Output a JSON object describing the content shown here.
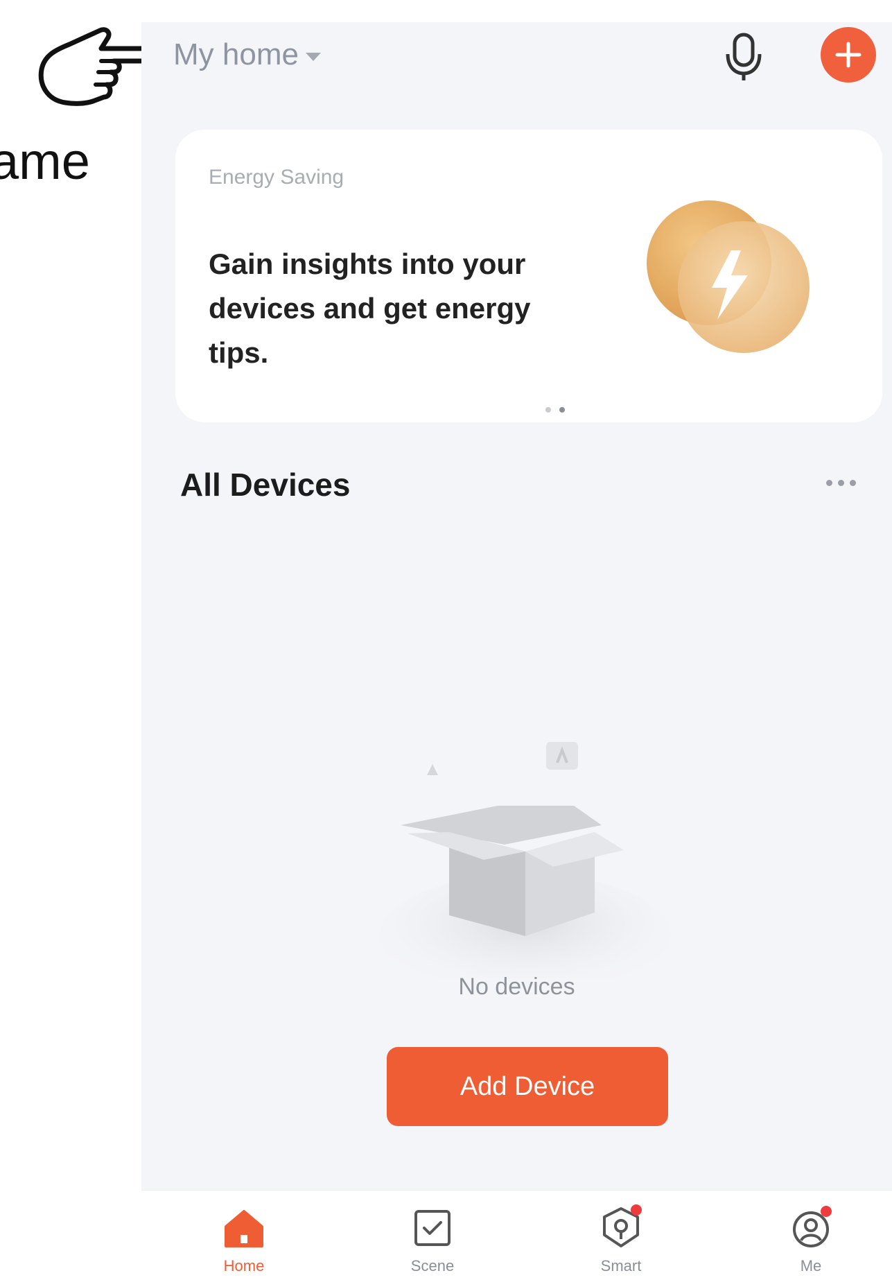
{
  "annotation": {
    "label": "ame"
  },
  "header": {
    "home_name": "My home"
  },
  "energy_card": {
    "tag": "Energy Saving",
    "message": "Gain insights into your devices and get energy tips."
  },
  "devices": {
    "title": "All Devices",
    "empty_text": "No devices",
    "add_button": "Add Device"
  },
  "tabbar": {
    "tabs": [
      {
        "label": "Home",
        "icon": "home-icon",
        "active": true
      },
      {
        "label": "Scene",
        "icon": "scene-icon",
        "active": false
      },
      {
        "label": "Smart",
        "icon": "smart-icon",
        "active": false
      },
      {
        "label": "Me",
        "icon": "profile-icon",
        "active": false
      }
    ]
  },
  "colors": {
    "accent": "#ef5d34",
    "background": "#f4f5f9",
    "energy_gold": "#e0a24e"
  }
}
